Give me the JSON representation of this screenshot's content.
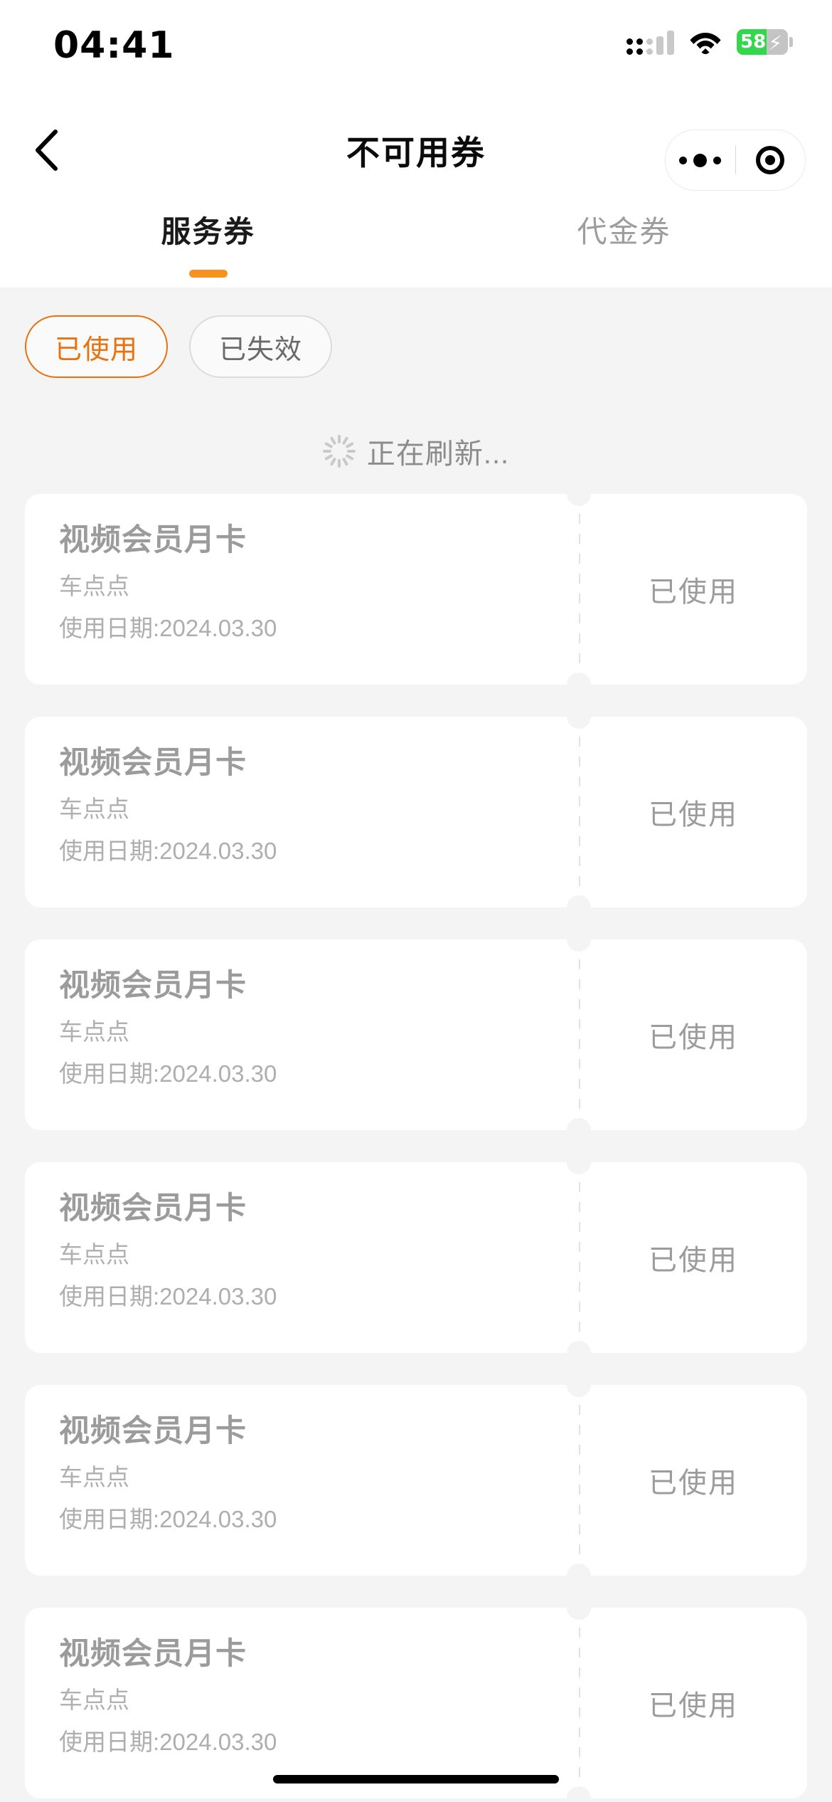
{
  "status_bar": {
    "time": "04:41",
    "signal_icon": "cellular-signal-icon",
    "wifi_icon": "wifi-icon",
    "battery_percent": "58",
    "battery_charging": true,
    "battery_icon": "battery-charging-icon"
  },
  "nav": {
    "back_icon": "chevron-left-icon",
    "title": "不可用券",
    "capsule": {
      "menu_icon": "more-dots-icon",
      "close_icon": "target-circle-icon"
    }
  },
  "tabs": [
    {
      "label": "服务券",
      "active": true
    },
    {
      "label": "代金券",
      "active": false
    }
  ],
  "filters": [
    {
      "label": "已使用",
      "active": true
    },
    {
      "label": "已失效",
      "active": false
    }
  ],
  "refresh": {
    "icon": "loading-spinner-icon",
    "text": "正在刷新..."
  },
  "coupons": [
    {
      "title": "视频会员月卡",
      "merchant": "车点点",
      "date": "使用日期:2024.03.30",
      "status": "已使用"
    },
    {
      "title": "视频会员月卡",
      "merchant": "车点点",
      "date": "使用日期:2024.03.30",
      "status": "已使用"
    },
    {
      "title": "视频会员月卡",
      "merchant": "车点点",
      "date": "使用日期:2024.03.30",
      "status": "已使用"
    },
    {
      "title": "视频会员月卡",
      "merchant": "车点点",
      "date": "使用日期:2024.03.30",
      "status": "已使用"
    },
    {
      "title": "视频会员月卡",
      "merchant": "车点点",
      "date": "使用日期:2024.03.30",
      "status": "已使用"
    },
    {
      "title": "视频会员月卡",
      "merchant": "车点点",
      "date": "使用日期:2024.03.30",
      "status": "已使用"
    }
  ],
  "colors": {
    "accent_orange": "#f5931e",
    "chip_active": "#e8720d",
    "page_bg": "#f4f4f4",
    "card_bg": "#ffffff",
    "battery_green": "#32d74b"
  },
  "home_indicator": "home-indicator"
}
